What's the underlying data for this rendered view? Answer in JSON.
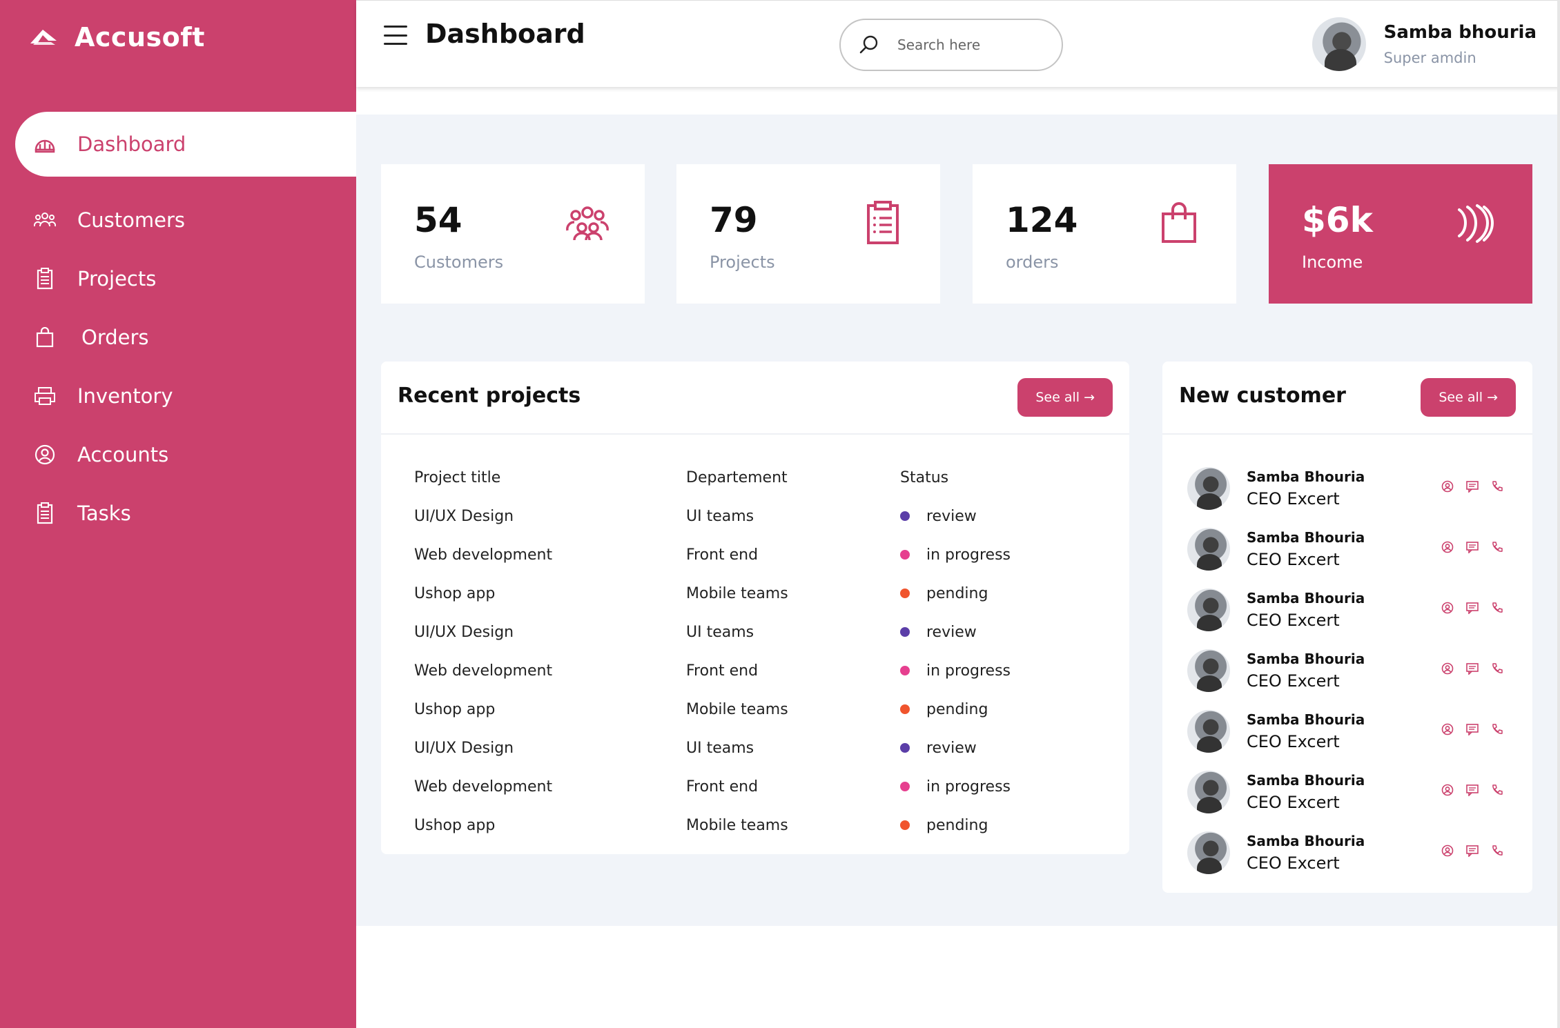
{
  "brand": {
    "name": "Accusoft",
    "icon": "brand-logo-icon"
  },
  "colors": {
    "accent": "#cb416d",
    "background": "#f1f4f9",
    "muted": "#8a94a6",
    "status_review": "#5b3ea8",
    "status_in_progress": "#e63f8f",
    "status_pending": "#f0542d"
  },
  "sidebar": {
    "items": [
      {
        "label": "Dashboard",
        "icon": "dashboard-icon",
        "active": true
      },
      {
        "label": "Customers",
        "icon": "users-icon"
      },
      {
        "label": "Projects",
        "icon": "clipboard-icon"
      },
      {
        "label": "Orders",
        "icon": "shopping-bag-icon"
      },
      {
        "label": "Inventory",
        "icon": "printer-icon"
      },
      {
        "label": "Accounts",
        "icon": "user-circle-icon"
      },
      {
        "label": "Tasks",
        "icon": "clipboard-list-icon"
      }
    ]
  },
  "header": {
    "title": "Dashboard",
    "search_placeholder": "Search here",
    "user": {
      "name": "Samba bhouria",
      "role": "Super amdin"
    }
  },
  "stats": [
    {
      "value": "54",
      "label": "Customers",
      "icon": "users-icon"
    },
    {
      "value": "79",
      "label": "Projects",
      "icon": "clipboard-icon"
    },
    {
      "value": "124",
      "label": "orders",
      "icon": "shopping-bag-icon"
    },
    {
      "value": "$6k",
      "label": "Income",
      "icon": "waves-icon"
    }
  ],
  "recent_projects": {
    "title": "Recent projects",
    "see_all": "See all →",
    "columns": [
      "Project title",
      "Departement",
      "Status"
    ],
    "rows": [
      {
        "title": "UI/UX Design",
        "department": "UI teams",
        "status": "review"
      },
      {
        "title": "Web development",
        "department": "Front end",
        "status": "in progress"
      },
      {
        "title": "Ushop app",
        "department": "Mobile teams",
        "status": "pending"
      },
      {
        "title": "UI/UX Design",
        "department": "UI teams",
        "status": "review"
      },
      {
        "title": "Web development",
        "department": "Front end",
        "status": "in progress"
      },
      {
        "title": "Ushop app",
        "department": "Mobile teams",
        "status": "pending"
      },
      {
        "title": "UI/UX Design",
        "department": "UI teams",
        "status": "review"
      },
      {
        "title": "Web development",
        "department": "Front end",
        "status": "in progress"
      },
      {
        "title": "Ushop app",
        "department": "Mobile teams",
        "status": "pending"
      }
    ]
  },
  "new_customer": {
    "title": "New customer",
    "see_all": "See all →",
    "customers": [
      {
        "name": "Samba Bhouria",
        "role": "CEO Excert"
      },
      {
        "name": "Samba Bhouria",
        "role": "CEO Excert"
      },
      {
        "name": "Samba Bhouria",
        "role": "CEO Excert"
      },
      {
        "name": "Samba Bhouria",
        "role": "CEO Excert"
      },
      {
        "name": "Samba Bhouria",
        "role": "CEO Excert"
      },
      {
        "name": "Samba Bhouria",
        "role": "CEO Excert"
      },
      {
        "name": "Samba Bhouria",
        "role": "CEO Excert"
      }
    ]
  }
}
